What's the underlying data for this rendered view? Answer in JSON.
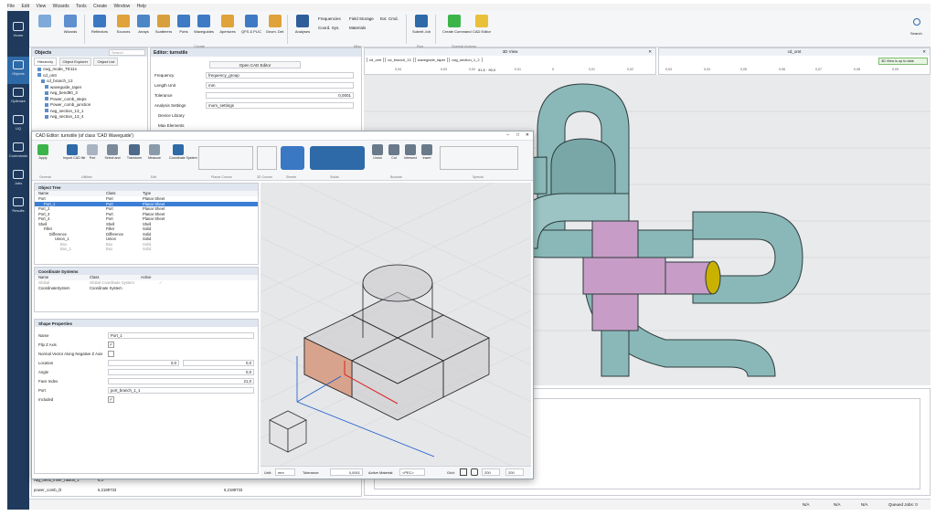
{
  "menubar": [
    "File",
    "Edit",
    "View",
    "Wizards",
    "Tools",
    "Create",
    "Window",
    "Help"
  ],
  "ribbon": {
    "items": [
      {
        "label": "Wizards"
      },
      {
        "label": "Reflectors"
      },
      {
        "label": "Sources"
      },
      {
        "label": "Arrays"
      },
      {
        "label": "Scatterers"
      },
      {
        "label": "Ports"
      },
      {
        "label": "Waveguides"
      },
      {
        "label": "Apertures"
      },
      {
        "label": "QFS & PLIC"
      },
      {
        "label": "Geom. Def."
      },
      {
        "label": "Analyses"
      }
    ],
    "small_items": [
      "Frequencies",
      "Coord. Sys.",
      "Field Storage",
      "Materials",
      "Ext. Cmd."
    ],
    "run_items": [
      {
        "label": "Submit Job"
      },
      {
        "label": "Create Command"
      },
      {
        "label": "CAD Editor"
      }
    ],
    "groups": [
      "Create",
      "Misc",
      "Run",
      "Special Actions"
    ],
    "search_label": "Search"
  },
  "leftnav": [
    "Home",
    "Objects",
    "Optimize",
    "UQ",
    "Commands",
    "Jobs",
    "Results"
  ],
  "objects_panel": {
    "title": "Objects",
    "search_placeholder": "Search",
    "tabs": [
      "Hierarchy",
      "Object Explorer",
      "Object List"
    ],
    "tree": [
      "cwg_mode_TE11s",
      "cd_omt",
      "cd_branch_13",
      "waveguide_taper",
      "rwg_bend90_3",
      "Power_comb_steps",
      "Power_comb_junction",
      "rwg_section_13_1",
      "rwg_section_13_4"
    ]
  },
  "editor_panel": {
    "title": "Editor: turnstile",
    "open_cad_button": "Open CAD Editor",
    "fields": [
      {
        "label": "Frequency",
        "value": "frequency_group"
      },
      {
        "label": "Length Unit",
        "value": "mm"
      },
      {
        "label": "Tolerance",
        "value": "0,0001"
      },
      {
        "label": "Analysis Settings",
        "value": "mom_settings"
      }
    ],
    "device_library": "Device Library",
    "max_elements": "Max Elements"
  },
  "view3d": {
    "title1": "3D View",
    "title2": "cd_omt",
    "path": [
      "cd_omt",
      "cd_branch_13",
      "waveguide_taper",
      "rwg_section_1_2"
    ],
    "status_btn": "3D View is up to date",
    "ruler": [
      "0,04",
      "0,03",
      "0,02",
      "0,01",
      "0",
      "0,01",
      "0,02",
      "0,03",
      "0,04",
      "0,05",
      "0,06",
      "0,07",
      "0,08",
      "0,09"
    ],
    "coord_values": [
      "91,5",
      "90,0"
    ]
  },
  "cad_dialog": {
    "title": "CAD Editor: turnstile (of class 'CAD Waveguide')",
    "tool_labels": [
      "Apply",
      "Import CAD file",
      "Port",
      "Select and",
      "Transform",
      "Measure",
      "Coordinate System"
    ],
    "tool_groups": [
      "General",
      "Utilities",
      "Edit",
      "Planar Curves",
      "3D Curves",
      "Sheets",
      "Solids",
      "Boolean",
      "Special"
    ],
    "bool_labels": [
      "Union",
      "Cut",
      "Intersect",
      "Insert"
    ],
    "object_tree": {
      "title": "Object Tree",
      "headers": [
        "Name",
        "Class",
        "Type"
      ],
      "rows": [
        {
          "name": "Port",
          "class": "Port",
          "type": "Planar Sheet"
        },
        {
          "name": "Port_1",
          "class": "Port",
          "type": "Planar Sheet",
          "selected": true
        },
        {
          "name": "Port_2",
          "class": "Port",
          "type": "Planar Sheet"
        },
        {
          "name": "Port_3",
          "class": "Port",
          "type": "Planar Sheet"
        },
        {
          "name": "Port_4",
          "class": "Port",
          "type": "Planar Sheet"
        },
        {
          "name": "Shell",
          "class": "Shell",
          "type": "Shell"
        },
        {
          "name": "Fillet",
          "class": "Fillet",
          "type": "Solid"
        },
        {
          "name": "Difference",
          "class": "Difference",
          "type": "Solid"
        },
        {
          "name": "Union_1",
          "class": "Union",
          "type": "Solid"
        },
        {
          "name": "Box",
          "class": "Box",
          "type": "Solid"
        },
        {
          "name": "Box_1",
          "class": "Box",
          "type": "Solid"
        }
      ]
    },
    "coordinate_systems": {
      "title": "Coordinate Systems",
      "headers": [
        "Name",
        "Class",
        "Active"
      ],
      "rows": [
        {
          "name": "Global",
          "class": "Global Coordinate System",
          "active": "✓"
        },
        {
          "name": "CoordinateSystem",
          "class": "Coordinate System",
          "active": ""
        }
      ]
    },
    "shape_properties": {
      "title": "Shape Properties",
      "rows": [
        {
          "label": "Name",
          "value": "Port_1"
        },
        {
          "label": "Flip Z Axis",
          "value": "✓"
        },
        {
          "label": "Normal Vector Along Negative Z Axis",
          "value": ""
        },
        {
          "label": "Location",
          "value": "0,0"
        },
        {
          "label": "Angle",
          "value": "0,0"
        },
        {
          "label": "Face Index",
          "value": "21,0"
        },
        {
          "label": "Port",
          "value": "port_branch_1_1"
        },
        {
          "label": "Included",
          "value": "✓"
        }
      ]
    },
    "status": {
      "unit_label": "Unit:",
      "unit": "mm",
      "tol_label": "Tolerance:",
      "tol": "0,0001",
      "mat_label": "Active Material:",
      "mat": "<PEC>",
      "grid_label": "Grid:",
      "grid_x": "200",
      "grid_y": "200"
    }
  },
  "bottom_table": {
    "rows": [
      {
        "name": "rwg_bend_inner_radius_1",
        "value": "6,3"
      },
      {
        "name": "power_comb_l3",
        "value": "6,2189733",
        "value2": "6,2189733"
      }
    ]
  },
  "statusbar": {
    "items": [
      "N/A",
      "N/A",
      "N/A"
    ],
    "queued": "Queued Jobs: 0"
  },
  "colors": {
    "nav": "#1f3a5c",
    "accent": "#2e6aa8",
    "model": "#8ab8b8",
    "port": "#c79dc7",
    "face": "#d8a38c"
  }
}
